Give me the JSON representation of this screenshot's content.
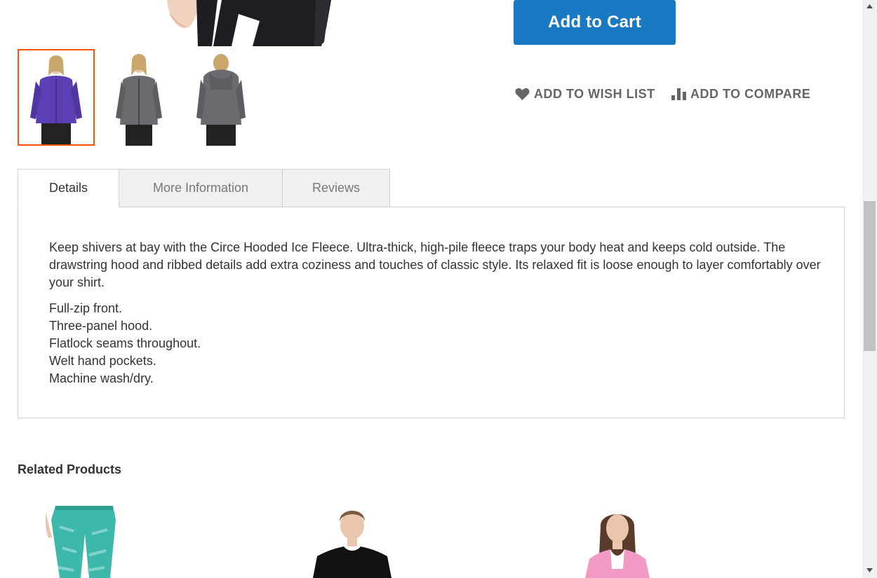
{
  "product": {
    "add_to_cart_label": "Add to Cart",
    "wishlist_label": "ADD TO WISH LIST",
    "compare_label": "ADD TO COMPARE"
  },
  "gallery": {
    "thumbnails": [
      {
        "color": "#5a3fb5",
        "active": true
      },
      {
        "color": "#6d6a6f",
        "active": false
      },
      {
        "color": "#6d6a6f",
        "active": false
      }
    ]
  },
  "tabs": [
    {
      "label": "Details",
      "active": true
    },
    {
      "label": "More Information",
      "active": false
    },
    {
      "label": "Reviews",
      "active": false
    }
  ],
  "details": {
    "description": "Keep shivers at bay with the Circe Hooded Ice Fleece. Ultra-thick, high-pile fleece traps your body heat and keeps cold outside. The drawstring hood and ribbed details add extra coziness and touches of classic style. Its relaxed fit is loose enough to layer comfortably over your shirt.",
    "features": [
      "Full-zip front.",
      "Three-panel hood.",
      "Flatlock seams throughout.",
      "Welt hand pockets.",
      "Machine wash/dry."
    ]
  },
  "related": {
    "title": "Related Products"
  },
  "colors": {
    "primary": "#1979c3",
    "active_border": "#ff5501"
  }
}
